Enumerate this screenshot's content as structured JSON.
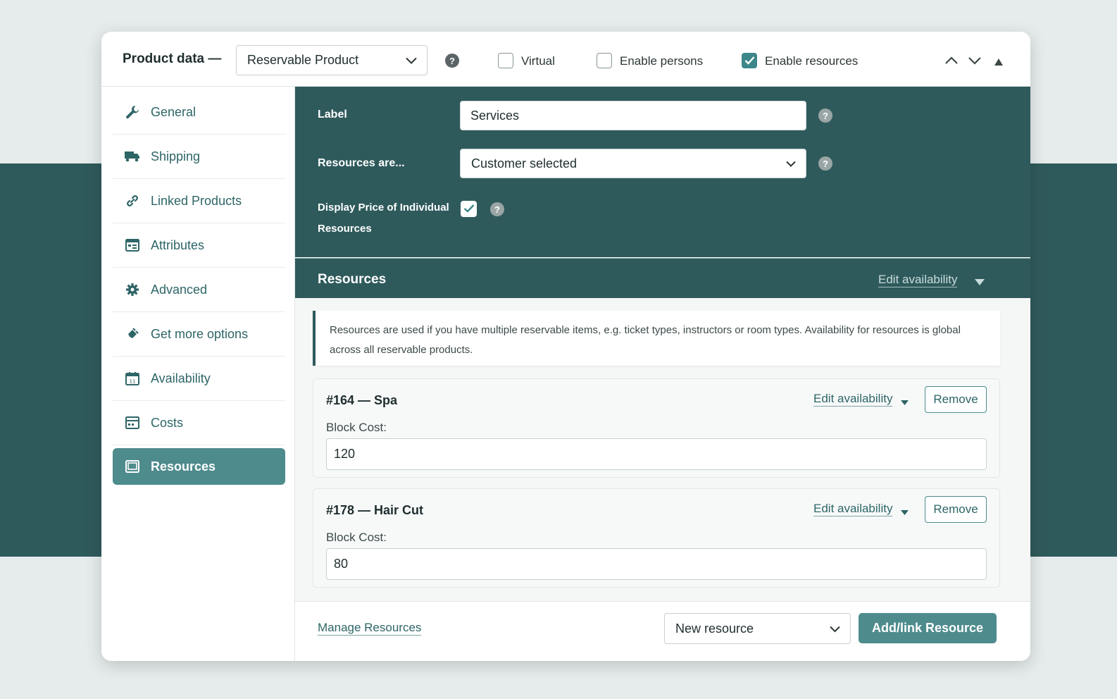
{
  "header": {
    "title": "Product data —",
    "product_type": "Reservable Product",
    "virtual_label": "Virtual",
    "virtual_checked": false,
    "persons_label": "Enable persons",
    "persons_checked": false,
    "resources_label": "Enable resources",
    "resources_checked": true
  },
  "sidebar": {
    "items": [
      {
        "label": "General",
        "icon": "wrench-icon"
      },
      {
        "label": "Shipping",
        "icon": "truck-icon"
      },
      {
        "label": "Linked Products",
        "icon": "link-icon"
      },
      {
        "label": "Attributes",
        "icon": "list-card-icon"
      },
      {
        "label": "Advanced",
        "icon": "gear-icon"
      },
      {
        "label": "Get more options",
        "icon": "plugin-icon"
      },
      {
        "label": "Availability",
        "icon": "calendar-icon"
      },
      {
        "label": "Costs",
        "icon": "costs-icon"
      },
      {
        "label": "Resources",
        "icon": "resources-icon",
        "active": true
      }
    ]
  },
  "settings": {
    "label_label": "Label",
    "label_value": "Services",
    "resources_are_label": "Resources are...",
    "resources_are_value": "Customer selected",
    "display_price_label_1": "Display Price of Individual",
    "display_price_label_2": "Resources",
    "display_price_checked": true
  },
  "resources_section": {
    "title": "Resources",
    "edit_availability": "Edit availability",
    "notice": "Resources are used if you have multiple reservable items, e.g. ticket types, instructors or room types. Availability for resources is global across all reservable products.",
    "items": [
      {
        "name": "#164 — Spa",
        "edit": "Edit availability",
        "remove": "Remove",
        "block_cost_label": "Block Cost:",
        "block_cost": "120"
      },
      {
        "name": "#178 — Hair Cut",
        "edit": "Edit availability",
        "remove": "Remove",
        "block_cost_label": "Block Cost:",
        "block_cost": "80"
      }
    ]
  },
  "footer": {
    "manage_link": "Manage Resources",
    "new_resource_select": "New resource",
    "add_button": "Add/link Resource"
  },
  "colors": {
    "accent": "#4e8b8d",
    "dark_teal": "#2f5a5c"
  }
}
